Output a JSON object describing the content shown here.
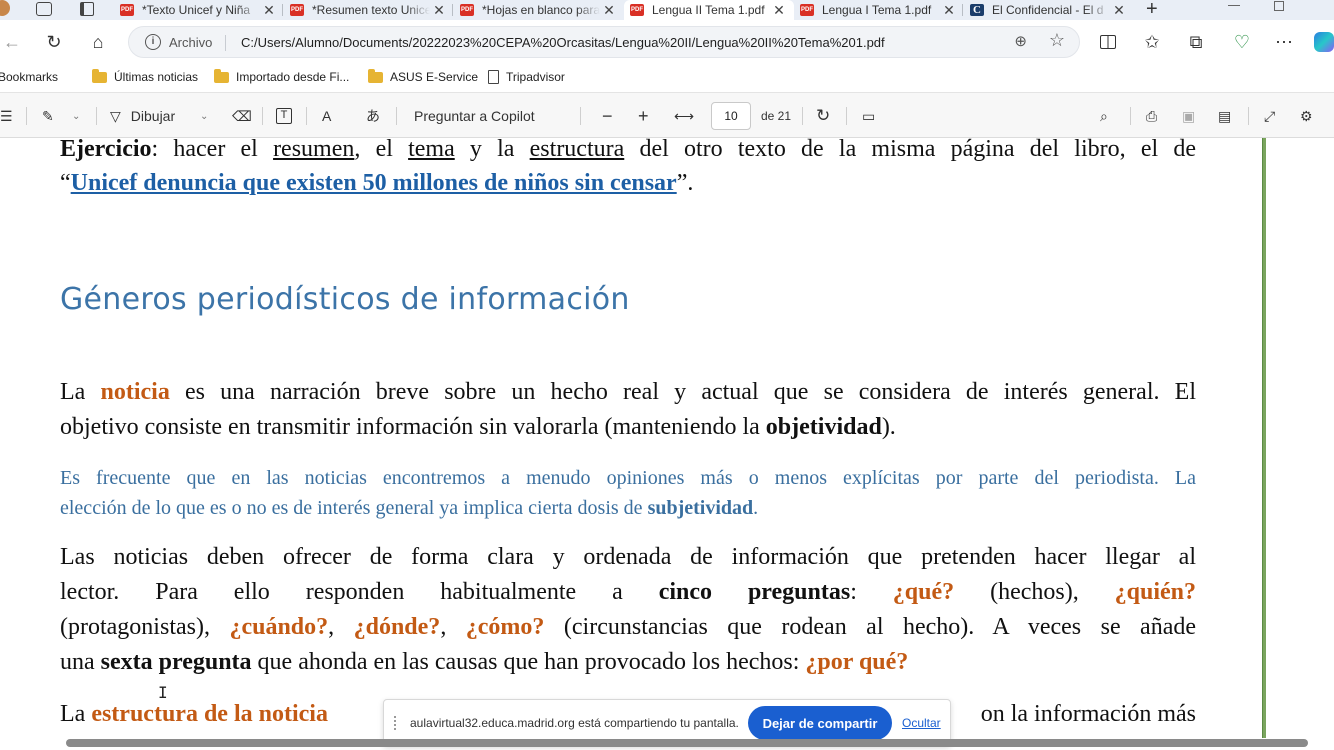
{
  "tabs": [
    {
      "title": "*Texto Unicef y Niña",
      "icon": "PDF"
    },
    {
      "title": "*Resumen texto Unicef",
      "icon": "PDF"
    },
    {
      "title": "*Hojas en blanco para",
      "icon": "PDF"
    },
    {
      "title": "Lengua II Tema 1.pdf",
      "icon": "PDF",
      "active": true
    },
    {
      "title": "Lengua I Tema 1.pdf",
      "icon": "PDF"
    },
    {
      "title": "El Confidencial - El d",
      "icon": "C"
    }
  ],
  "address": {
    "scheme_label": "Archivo",
    "url": "C:/Users/Alumno/Documents/20222023%20CEPA%20Orcasitas/Lengua%20II/Lengua%20II%20Tema%201.pdf"
  },
  "bookmarks": [
    {
      "label": "Bookmarks",
      "type": "none"
    },
    {
      "label": "Últimas noticias",
      "type": "folder"
    },
    {
      "label": "Importado desde Fi...",
      "type": "folder"
    },
    {
      "label": "ASUS E-Service",
      "type": "folder"
    },
    {
      "label": "Tripadvisor",
      "type": "page"
    }
  ],
  "pdf_toolbar": {
    "draw_label": "Dibujar",
    "copilot_label": "Preguntar a Copilot",
    "current_page": "10",
    "total_pages": "de 21"
  },
  "doc": {
    "ex_label": "Ejercicio",
    "ex_1": ": hacer el ",
    "ex_resumen": "resumen",
    "ex_2": ", el ",
    "ex_tema": "tema",
    "ex_3": " y la ",
    "ex_estructura": "estructura",
    "ex_4": " del otro texto de la misma página del libro, el de",
    "ex_q_open": "“",
    "ex_link": "Unicef denuncia que existen 50 millones de niños sin censar",
    "ex_q_close": "”.",
    "heading": "Géneros periodísticos de información",
    "p1_a": "La ",
    "p1_noticia": "noticia",
    "p1_b": " es una narración breve sobre un hecho real y actual que se considera de interés general. El",
    "p1_c": "objetivo consiste en transmitir información sin valorarla (manteniendo la ",
    "p1_obj": "objetividad",
    "p1_d": ").",
    "p2_a": "Es frecuente que en las noticias encontremos a menudo opiniones más o menos explícitas por parte del periodista. La",
    "p2_b": "elección de lo que es o no es de interés general ya implica cierta dosis de ",
    "p2_subj": "subjetividad",
    "p2_c": ".",
    "p3_l1": "Las noticias deben ofrecer de forma clara y ordenada de información que pretenden hacer llegar al",
    "p3_l2a": "lector. Para ello responden habitualmente a ",
    "p3_cinco": "cinco preguntas",
    "p3_l2b": ": ",
    "q_que": "¿qué?",
    "p3_l2c": " (hechos), ",
    "q_quien": "¿quién?",
    "p3_l3a": "(protagonistas), ",
    "q_cuando": "¿cuándo?",
    "comma1": ", ",
    "q_donde": "¿dónde?",
    "comma2": ", ",
    "q_como": "¿cómo?",
    "p3_l3b": " (circunstancias que rodean al hecho). A veces se añade",
    "p3_l4a": "una ",
    "p3_sexta": "sexta pregunta",
    "p3_l4b": " que ahonda en las causas que han provocado los hechos: ",
    "q_porque": "¿por qué?",
    "p4_a": "La ",
    "p4_estr": "estructura de la noticia",
    "p4_tail": "on la información más"
  },
  "share": {
    "message": "aulavirtual32.educa.madrid.org está compartiendo tu pantalla.",
    "stop_label": "Dejar de compartir",
    "hide_label": "Ocultar"
  },
  "colors": {
    "accent": "#1a5fd0",
    "heading": "#3c74a8",
    "highlight": "#c35a14",
    "note": "#3a6f9f"
  }
}
